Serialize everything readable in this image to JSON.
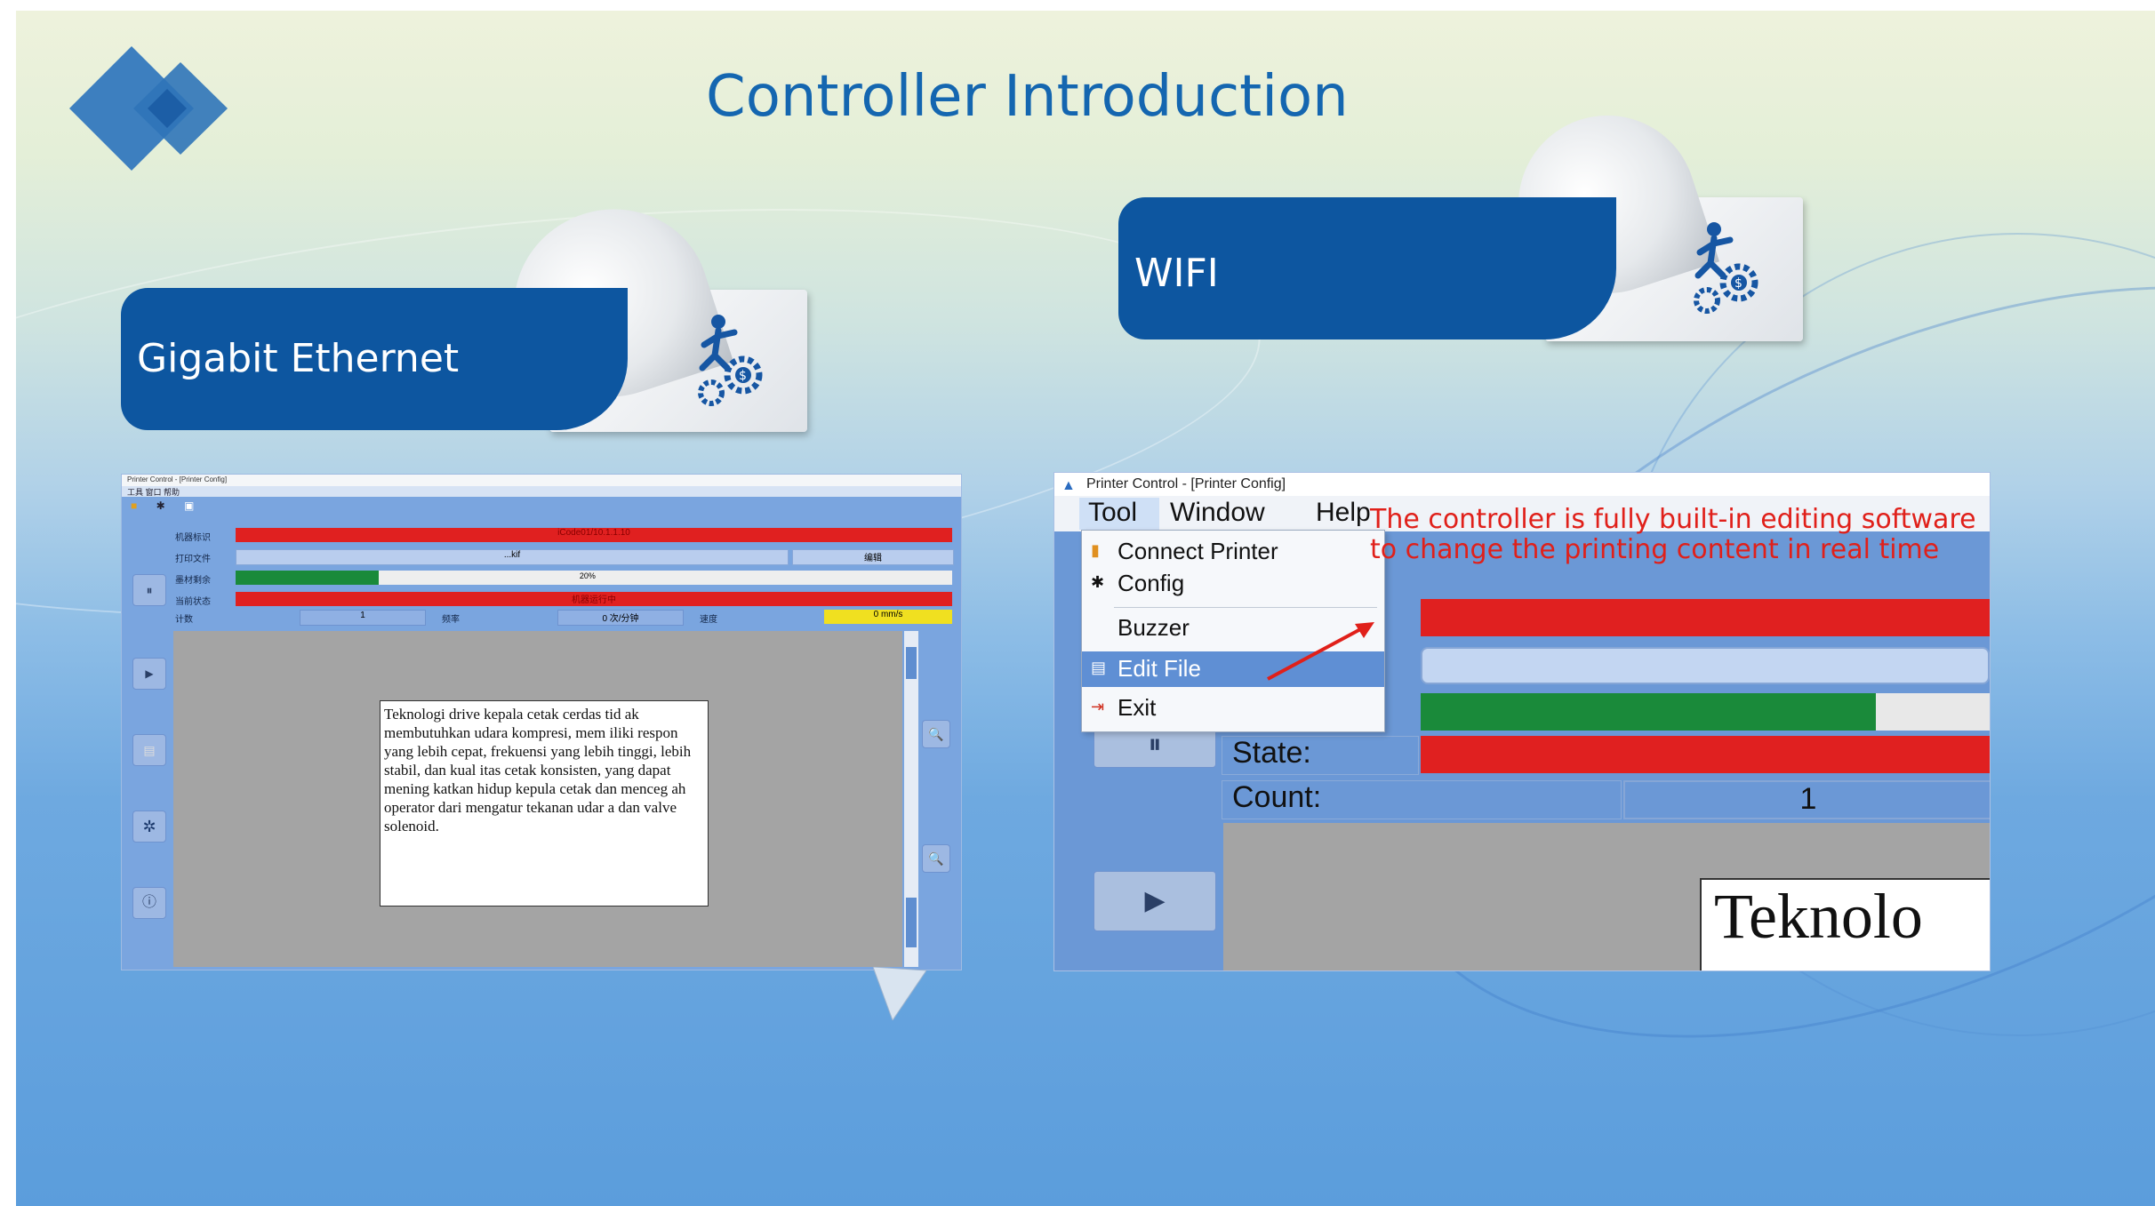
{
  "slide": {
    "title": "Controller Introduction",
    "banner_left": "Gigabit Ethernet",
    "banner_right": "WIFI"
  },
  "left_screenshot": {
    "titlebar": "Printer Control - [Printer Config]",
    "menubar": "工具  窗口  帮助",
    "rows": [
      {
        "label": "机器标识",
        "value": "iCode01/10.1.1.10",
        "color": "red"
      },
      {
        "label": "打印文件",
        "value": "...kif",
        "extra": "编辑",
        "color": "blue"
      },
      {
        "label": "墨材剩余",
        "value": "20%",
        "color": "green"
      },
      {
        "label": "当前状态",
        "value": "机器运行中",
        "color": "red"
      }
    ],
    "count_row": {
      "count_label": "计数",
      "count_value": "1",
      "speed_label": "频率",
      "speed_value": "0 次/分钟",
      "speed2_label": "速度",
      "speed2_value": "0 mm/s"
    },
    "text_box": "Teknologi drive kepala cetak cerdas tid ak membutuhkan udara kompresi, mem iliki respon yang lebih cepat, frekuensi yang lebih tinggi, lebih stabil, dan kual itas cetak konsisten, yang dapat mening katkan hidup kepula cetak dan menceg ah operator dari mengatur tekanan udar a dan valve solenoid."
  },
  "right_screenshot": {
    "titlebar": "Printer Control - [Printer Config]",
    "menu": [
      "Tool",
      "Window",
      "Help"
    ],
    "dropdown": [
      {
        "icon": "connect-icon",
        "label": "Connect Printer"
      },
      {
        "icon": "gear-icon",
        "label": "Config"
      },
      {
        "icon": "",
        "label": "Buzzer"
      },
      {
        "icon": "edit-icon",
        "label": "Edit File"
      },
      {
        "icon": "exit-icon",
        "label": "Exit"
      }
    ],
    "annotation": "The controller is fully built-in editing software to change the printing content in real time",
    "state_label": "State:",
    "count_label": "Count:",
    "count_value": "1",
    "preview_text": "Teknolo"
  },
  "colors": {
    "brand_blue": "#0d56a0",
    "title_blue": "#1466b0",
    "status_red": "#e02020",
    "status_green": "#1a8a3a",
    "annotation_red": "#e0201a"
  }
}
